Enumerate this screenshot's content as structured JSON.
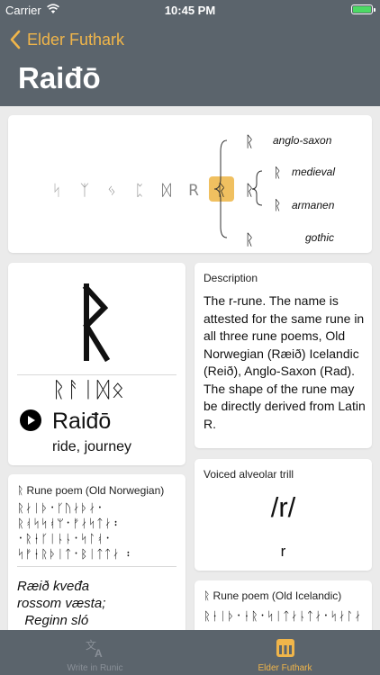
{
  "status_bar": {
    "carrier": "Carrier",
    "time": "10:45 PM"
  },
  "nav": {
    "back_label": "Elder Futhark",
    "title": "Raiđō"
  },
  "evolution": {
    "history": [
      "ᛋ",
      "ᛉ",
      "ᛃ",
      "ᛈ",
      "ᛞ",
      "R"
    ],
    "selected": "ᚱ",
    "branches": [
      {
        "glyph": "ᚱ",
        "label": "anglo-saxon"
      },
      {
        "glyph": "ᚱ",
        "label": "medieval"
      },
      {
        "glyph": "ᚱ",
        "label": "armanen"
      },
      {
        "glyph": "ᚱ",
        "label": "gothic"
      }
    ],
    "highlight_color": "#f0c060"
  },
  "rune": {
    "glyph": "ᚱ",
    "runic_name": "ᚱᚨᛁᛞᛟ",
    "name": "Raiđō",
    "meaning": "ride, journey"
  },
  "description": {
    "label": "Description",
    "text": "The r-rune. The name is attested for the same rune in all three rune poems, Old Norwegian (Ræið) Icelandic (Reið), Anglo-Saxon (Rad). The shape of the rune may be directly derived from Latin R."
  },
  "poem_norwegian": {
    "label": "ᚱ Rune poem (Old Norwegian)",
    "runic": "ᚱᛅᛁᚦ᛫ᚴᚢᛅᚦᛅ᛫\nᚱᚮᛋᛋᚮᛘ᛫ᚠᛅᛋᛏᛅ᛬\n᛫ᚱᛂᚴᛁᚿᚿ᛫ᛋᛚᚮ᛫\nᛋᚠᛂᚱᚦᛁᛏ᛫ᛒᛁᛏᛏᛅ ᛬",
    "text": "Ræið kveđa\nrossom væsta;\n  Reginn sló"
  },
  "sound": {
    "label": "Voiced alveolar trill",
    "ipa": "/r/",
    "letter": "r"
  },
  "poem_icelandic": {
    "label": "ᚱ Rune poem (Old Icelandic)",
    "runic": "ᚱᛂᛁᚦ᛫ᛂᚱ᛫ᛋᛁᛏᛅᚿᛏᛅ᛫ᛋᛅᛚᛅ"
  },
  "tab_bar": {
    "tabs": [
      {
        "label": "Write in Runic"
      },
      {
        "label": "Elder Futhark"
      }
    ],
    "active_color": "#f0b54a"
  }
}
